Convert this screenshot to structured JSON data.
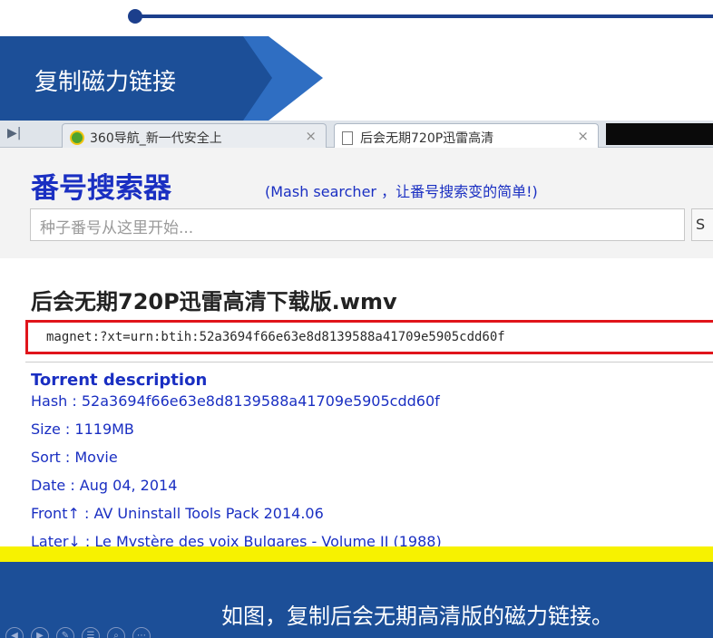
{
  "slide": {
    "banner_title": "复制磁力链接",
    "caption": "如图，复制后会无期高清版的磁力链接。",
    "nav_icons": [
      "prev-icon",
      "next-icon",
      "pen-icon",
      "menu-icon",
      "zoom-icon",
      "more-icon"
    ]
  },
  "browser": {
    "tabs": [
      {
        "label": "360导航_新一代安全上",
        "icon": "360-icon"
      },
      {
        "label": "后会无期720P迅雷高清",
        "icon": "page-icon"
      }
    ],
    "close_glyph": "×"
  },
  "site": {
    "brand": "番号搜索器",
    "brand_sub": "(Mash searcher ，让番号搜索变的简单!)",
    "search": {
      "placeholder": "种子番号从这里开始...",
      "button_label": "S"
    }
  },
  "result": {
    "title": "后会无期720P迅雷高清下载版.wmv",
    "magnet": "magnet:?xt=urn:btih:52a3694f66e63e8d8139588a41709e5905cdd60f",
    "description_heading": "Torrent description",
    "details": [
      "Hash : 52a3694f66e63e8d8139588a41709e5905cdd60f",
      "Size : 1119MB",
      "Sort : Movie",
      "Date : Aug 04, 2014",
      "Front↑ : AV Uninstall Tools Pack 2014.06",
      "Later↓ : Le Mystère des voix Bulgares - Volume II (1988)"
    ]
  },
  "colors": {
    "slide_blue": "#1c4f98",
    "brand_blue": "#1a2fc2",
    "highlight_red": "#e0151b",
    "highlight_yellow": "#f7f200"
  }
}
